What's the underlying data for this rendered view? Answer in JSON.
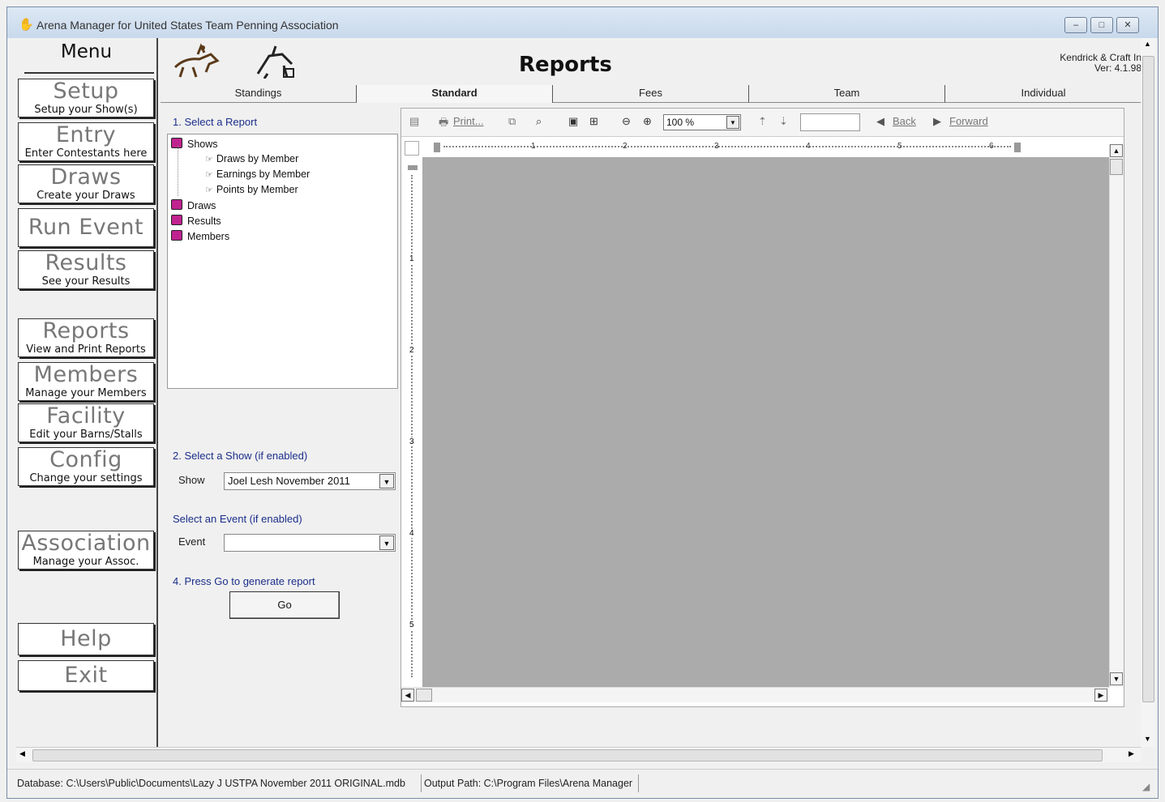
{
  "window": {
    "title": "Arena Manager for United States Team Penning Association",
    "minimize": "–",
    "maximize": "□",
    "close": "✕"
  },
  "menu": {
    "title": "Menu",
    "buttons": [
      {
        "big": "Setup",
        "small": "Setup your Show(s)"
      },
      {
        "big": "Entry",
        "small": "Enter Contestants here"
      },
      {
        "big": "Draws",
        "small": "Create your Draws"
      },
      {
        "big": "Run Event",
        "small": ""
      },
      {
        "big": "Results",
        "small": "See your Results"
      },
      {
        "big": "Reports",
        "small": "View and Print Reports"
      },
      {
        "big": "Members",
        "small": "Manage your Members"
      },
      {
        "big": "Facility",
        "small": "Edit your Barns/Stalls"
      },
      {
        "big": "Config",
        "small": "Change your settings"
      },
      {
        "big": "Association",
        "small": "Manage your Assoc."
      },
      {
        "big": "Help",
        "small": ""
      },
      {
        "big": "Exit",
        "small": ""
      }
    ]
  },
  "header": {
    "title": "Reports",
    "company": "Kendrick & Craft In",
    "version": "Ver: 4.1.98"
  },
  "tabs": [
    {
      "label": "Standings",
      "active": false
    },
    {
      "label": "Standard",
      "active": true
    },
    {
      "label": "Fees",
      "active": false
    },
    {
      "label": "Team",
      "active": false
    },
    {
      "label": "Individual",
      "active": false
    }
  ],
  "report_panel": {
    "step1": "1. Select a Report",
    "tree": {
      "shows": "Shows",
      "draws_by_member": "Draws by Member",
      "earnings_by_member": "Earnings by Member",
      "points_by_member": "Points by Member",
      "draws": "Draws",
      "results": "Results",
      "members": "Members"
    },
    "step2": "2. Select a Show (if enabled)",
    "show_label": "Show",
    "show_value": "Joel Lesh November 2011",
    "step3": "Select an Event (if enabled)",
    "event_label": "Event",
    "event_value": "",
    "step4": "4. Press Go to generate report",
    "go_label": "Go"
  },
  "viewer": {
    "print": "Print...",
    "zoom": "100 %",
    "back": "Back",
    "forward": "Forward",
    "ruler_numbers": [
      "1",
      "2",
      "3",
      "4",
      "5",
      "6"
    ],
    "vruler_numbers": [
      "1",
      "2",
      "3",
      "4",
      "5"
    ]
  },
  "status": {
    "database": "Database: C:\\Users\\Public\\Documents\\Lazy J USTPA November 2011 ORIGINAL.mdb",
    "output": "Output Path: C:\\Program Files\\Arena Manager"
  },
  "colors": {
    "canvas": "#ababab",
    "step_text": "#1a2e8a",
    "book_icon": "#c0238f"
  }
}
